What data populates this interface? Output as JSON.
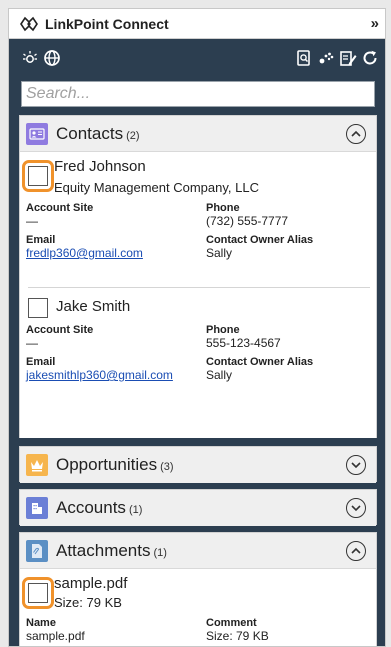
{
  "app": {
    "title": "LinkPoint Connect",
    "expand_glyph": "»"
  },
  "toolbar": {
    "left_icons": [
      "lightbulb-icon",
      "globe-icon"
    ],
    "right_icons": [
      "document-search-icon",
      "paw-icon",
      "edit-document-icon",
      "refresh-icon"
    ]
  },
  "search": {
    "placeholder": "Search..."
  },
  "sections": {
    "contacts": {
      "title": "Contacts",
      "count": "(2)",
      "expanded": true,
      "records": [
        {
          "name": "Fred Johnson",
          "company": "Equity Management Company, LLC",
          "account_site_label": "Account Site",
          "account_site_value": "—",
          "phone_label": "Phone",
          "phone_value": "(732) 555-7777",
          "email_label": "Email",
          "email_value": "fredlp360@gmail.com",
          "owner_label": "Contact Owner Alias",
          "owner_value": "Sally"
        },
        {
          "name": "Jake Smith",
          "account_site_label": "Account Site",
          "account_site_value": "—",
          "phone_label": "Phone",
          "phone_value": "555-123-4567",
          "email_label": "Email",
          "email_value": "jakesmithlp360@gmail.com",
          "owner_label": "Contact Owner Alias",
          "owner_value": "Sally"
        }
      ]
    },
    "opportunities": {
      "title": "Opportunities",
      "count": "(3)",
      "expanded": false
    },
    "accounts": {
      "title": "Accounts",
      "count": "(1)",
      "expanded": false
    },
    "attachments": {
      "title": "Attachments",
      "count": "(1)",
      "expanded": true,
      "records": [
        {
          "name": "sample.pdf",
          "size": "Size: 79 KB",
          "name_label": "Name",
          "name_value": "sample.pdf",
          "comment_label": "Comment",
          "comment_value": "Size: 79 KB"
        }
      ]
    }
  },
  "colors": {
    "toolbar_bg": "#2c3e50",
    "contacts_icon": "#8f7be0",
    "opportunities_icon": "#f6b54d",
    "accounts_icon": "#6b7fd6",
    "attachments_icon": "#5b8fc4",
    "highlight": "#f0922b",
    "link": "#1a4db3"
  }
}
